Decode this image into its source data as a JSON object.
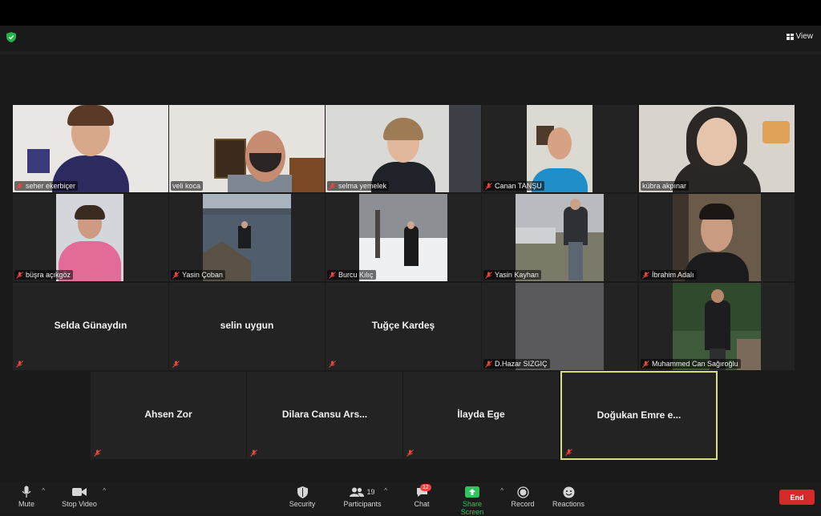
{
  "header": {
    "view_label": "View"
  },
  "participants": {
    "row1": [
      "seher ekerbiçer",
      "veli koca",
      "selma yemelek",
      "Canan TANŞU",
      "kübra akpınar"
    ],
    "row2": [
      "büşra açıkgöz",
      "Yasin Çoban",
      "Burcu Kılıç",
      "Yasin Kayhan",
      "İbrahim Adalı"
    ],
    "row3": [
      "Selda Günaydın",
      "selin uygun",
      "Tuğçe Kardeş",
      "D.Hazar SIZGIÇ",
      "Muhammed Can Sağıroğlu"
    ],
    "row4": [
      "Ahsen Zor",
      "Dilara Cansu Ars...",
      "İlayda Ege",
      "Doğukan Emre e..."
    ]
  },
  "toolbar": {
    "mute": "Mute",
    "stop_video": "Stop Video",
    "security": "Security",
    "participants": "Participants",
    "participants_count": "19",
    "chat": "Chat",
    "chat_badge": "12",
    "share_screen": "Share Screen",
    "record": "Record",
    "reactions": "Reactions",
    "end": "End"
  },
  "colors": {
    "active_speaker_border": "#d8e07a",
    "share_green": "#33c35a",
    "end_red": "#d42a2a",
    "muted_red": "#e8473c"
  }
}
